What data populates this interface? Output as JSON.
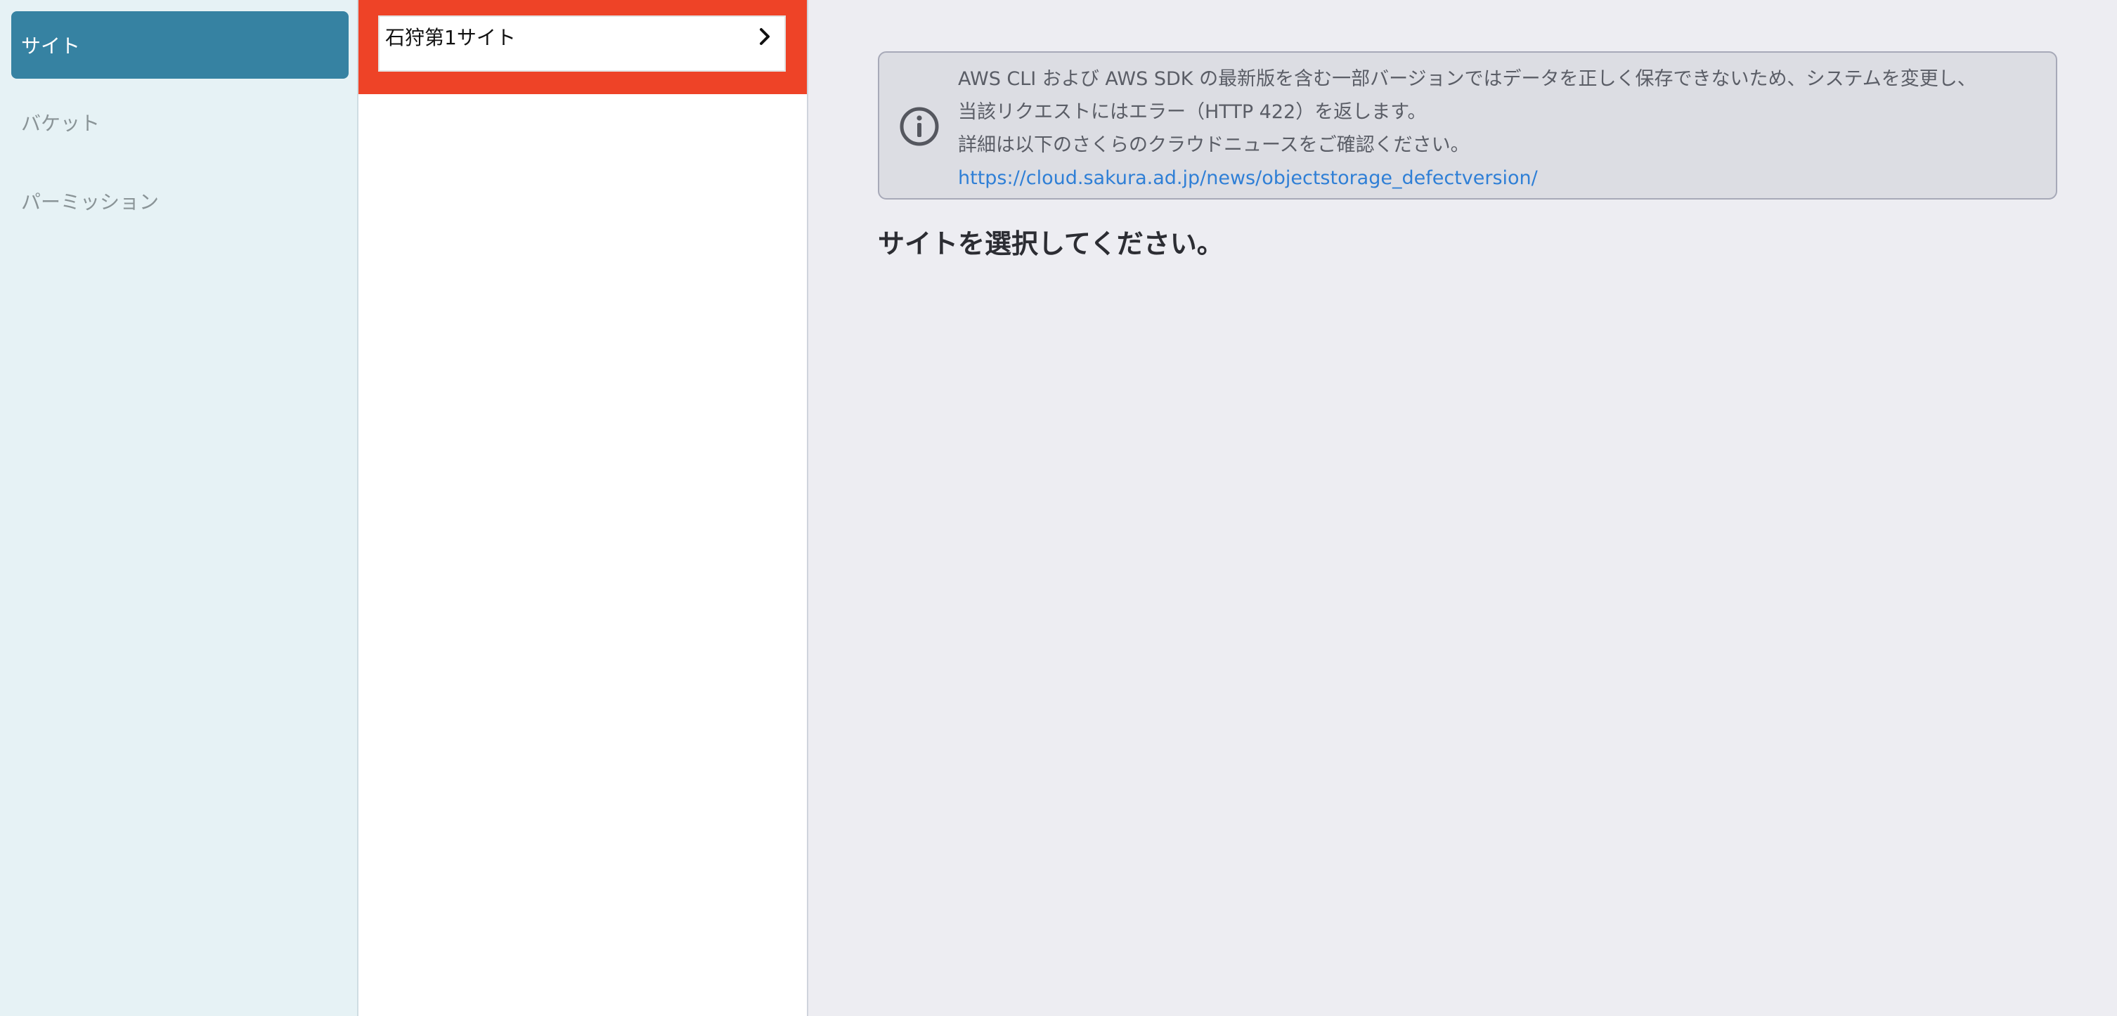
{
  "sidebar": {
    "items": [
      {
        "label": "サイト",
        "active": true
      },
      {
        "label": "バケット",
        "active": false
      },
      {
        "label": "パーミッション",
        "active": false
      }
    ]
  },
  "sites": {
    "items": [
      {
        "label": "石狩第1サイト"
      }
    ]
  },
  "notice": {
    "icon": "info-icon",
    "line1": "AWS CLI および AWS SDK の最新版を含む一部バージョンではデータを正しく保存できないため、システムを変更し、",
    "line2": "当該リクエストにはエラー（HTTP 422）を返します。",
    "line3": "詳細は以下のさくらのクラウドニュースをご確認ください。",
    "link": "https://cloud.sakura.ad.jp/news/objectstorage_defectversion/"
  },
  "main": {
    "prompt": "サイトを選択してください。"
  },
  "colors": {
    "sidebar_bg": "#e6f2f5",
    "nav_active": "#3682a2",
    "highlight": "#ee4327",
    "link": "#2f7fd6"
  }
}
